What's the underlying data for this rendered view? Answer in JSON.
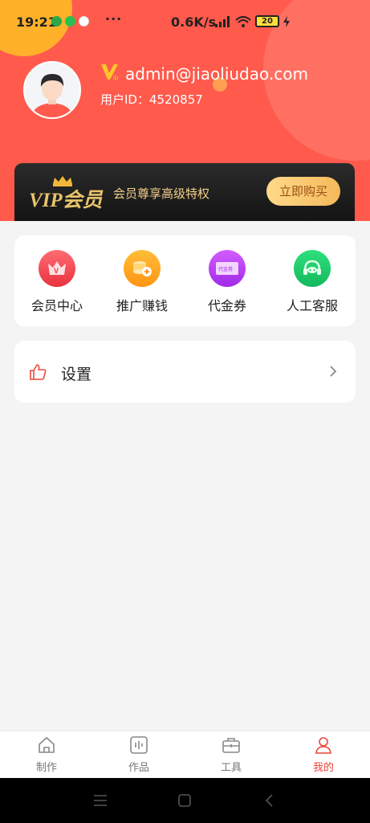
{
  "status_bar": {
    "time": "19:21",
    "more": "···",
    "net_speed": "0.6K/s",
    "battery": "20"
  },
  "profile": {
    "email": "admin@jiaoliudao.com",
    "user_id": "用户ID：4520857"
  },
  "vip_banner": {
    "logo_text": "VIP会员",
    "slogan": "会员尊享高级特权",
    "buy_label": "立即购买"
  },
  "menu": [
    {
      "label": "会员中心",
      "icon": "crown-v-icon",
      "color": "#f0444e"
    },
    {
      "label": "推广赚钱",
      "icon": "coins-icon",
      "color": "#ffa51f"
    },
    {
      "label": "代金券",
      "icon": "voucher-icon",
      "color": "#b93bf0"
    },
    {
      "label": "人工客服",
      "icon": "headset-icon",
      "color": "#19c76a"
    }
  ],
  "voucher_icon_text": "代金券",
  "settings": {
    "label": "设置"
  },
  "tabs": [
    {
      "label": "制作",
      "icon": "home-icon",
      "active": false
    },
    {
      "label": "作品",
      "icon": "works-icon",
      "active": false
    },
    {
      "label": "工具",
      "icon": "toolbox-icon",
      "active": false
    },
    {
      "label": "我的",
      "icon": "person-icon",
      "active": true
    }
  ],
  "colors": {
    "header": "#ff5a4c",
    "accent": "#e8453c",
    "vip_gold": "#f3cf8a"
  }
}
